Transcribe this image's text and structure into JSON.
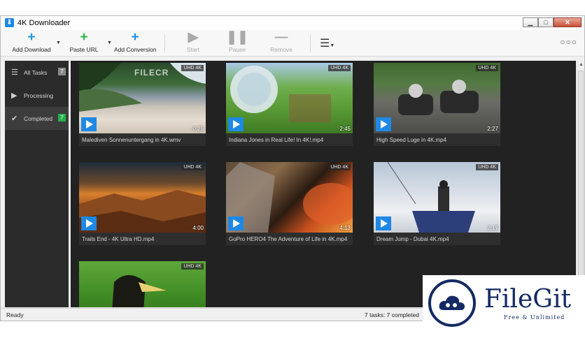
{
  "window": {
    "title": "4K Downloader"
  },
  "toolbar": {
    "add_download": "Add Download",
    "paste_url": "Paste URL",
    "add_conversion": "Add Conversion",
    "start": "Start",
    "pause": "Pause",
    "remove": "Remove",
    "menu_icon": "hamburger-menu-icon",
    "more_icon": "more-icon"
  },
  "sidebar": {
    "items": [
      {
        "label": "All Tasks",
        "badge": "7",
        "icon": "list-icon"
      },
      {
        "label": "Processing",
        "badge": "",
        "icon": "play-icon"
      },
      {
        "label": "Completed",
        "badge": "7",
        "icon": "check-icon"
      }
    ]
  },
  "watermark_small": "FILECR",
  "videos": [
    {
      "title": "Malediven Sonnenuntergang in 4K.wmv",
      "quality": "UHD 4K",
      "duration": "0:25"
    },
    {
      "title": "Indiana Jones in Real Life! In 4K!.mp4",
      "quality": "UHD 4K",
      "duration": "2:45"
    },
    {
      "title": "High Speed Luge in 4K.mp4",
      "quality": "UHD 4K",
      "duration": "2:27"
    },
    {
      "title": "Trails End - 4K Ultra HD.mp4",
      "quality": "UHD 4K",
      "duration": "4:00"
    },
    {
      "title": "GoPro HERO4  The Adventure of Life in 4K.mp4",
      "quality": "UHD 4K",
      "duration": "4:13"
    },
    {
      "title": "Dream Jump - Dubai 4K.mp4",
      "quality": "UHD 4K",
      "duration": "2:17"
    },
    {
      "title": "",
      "quality": "UHD 4K",
      "duration": ""
    }
  ],
  "status": {
    "left": "Ready",
    "right": "7 tasks: 7 completed"
  },
  "brand": {
    "name": "FileGit",
    "tagline": "Free & Unlimited",
    "color": "#142a63"
  },
  "colors": {
    "accent": "#1e88e5",
    "sidebar_bg": "#2b2b2b",
    "content_bg": "#222222",
    "badge_green": "#24b14c"
  }
}
